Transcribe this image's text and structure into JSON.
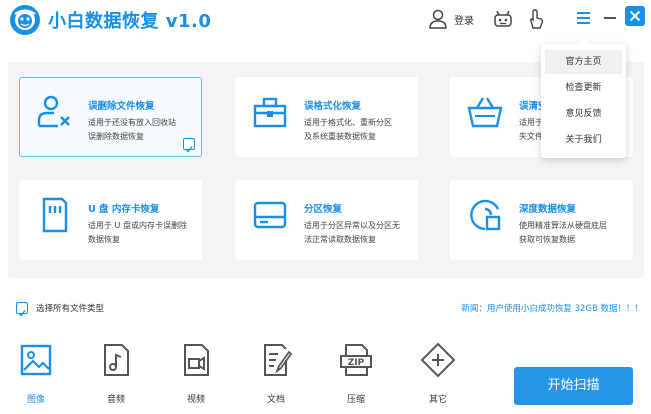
{
  "app": {
    "title": "小白数据恢复 v1.0"
  },
  "titlebar": {
    "login_label": "登录"
  },
  "cards": [
    {
      "title": "误删除文件恢复",
      "desc": [
        "适用于还没有放入回收站",
        "误删除数据恢复"
      ],
      "icon": "user-delete-icon",
      "selected": true
    },
    {
      "title": "误格式化恢复",
      "desc": [
        "适用于格式化、重新分区",
        "及系统重装数据恢复"
      ],
      "icon": "toolbox-icon"
    },
    {
      "title": "误清空回收站恢复",
      "desc": [
        "适用于清空回收站",
        "失文件恢复"
      ],
      "icon": "basket-icon"
    },
    {
      "title": "U 盘 内存卡恢复",
      "desc": [
        "适用于 U 盘或内存卡误删除",
        "数据恢复"
      ],
      "icon": "sd-card-icon"
    },
    {
      "title": "分区恢复",
      "desc": [
        "适用于分区异常以及分区无",
        "法正常读取数据恢复"
      ],
      "icon": "disk-icon"
    },
    {
      "title": "深度数据恢复",
      "desc": [
        "使用精准算法从硬盘底层",
        "获取可恢复数据"
      ],
      "icon": "deep-scan-icon"
    }
  ],
  "select_all_label": "选择所有文件类型",
  "news": "新闻：用户使用小白成功恢复 32GB 数据！！！",
  "file_types": [
    {
      "label": "图像",
      "icon": "image-icon",
      "active": true
    },
    {
      "label": "音频",
      "icon": "audio-icon"
    },
    {
      "label": "视频",
      "icon": "video-icon"
    },
    {
      "label": "文档",
      "icon": "document-icon"
    },
    {
      "label": "压缩",
      "icon": "zip-icon"
    },
    {
      "label": "其它",
      "icon": "other-icon"
    }
  ],
  "scan_button": "开始扫描",
  "dropdown": [
    "官方主页",
    "检查更新",
    "意见反馈",
    "关于我们"
  ],
  "colors": {
    "accent": "#1a8fe8",
    "button": "#2695e8",
    "panel": "#f3f4f6"
  }
}
